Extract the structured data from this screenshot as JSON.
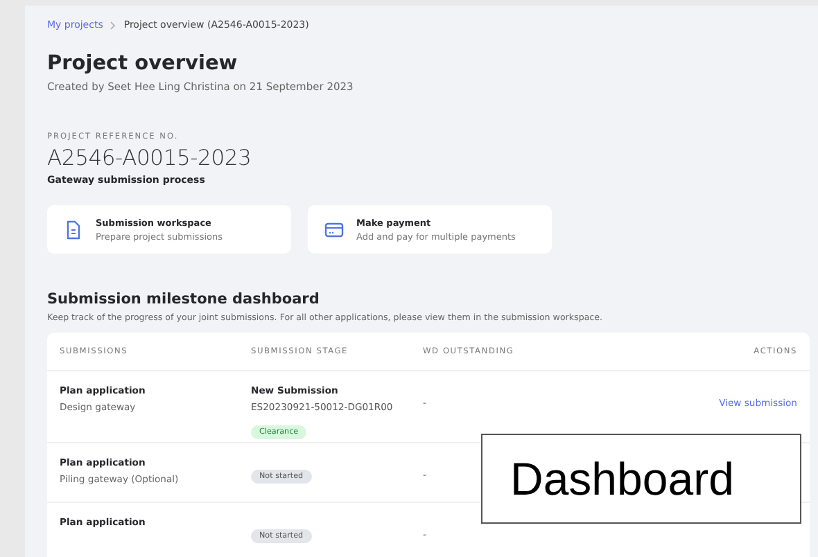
{
  "breadcrumb": [
    {
      "label": "My projects",
      "kind": "link"
    },
    {
      "label": "Project overview (A2546-A0015-2023)",
      "kind": "current"
    }
  ],
  "title": "Project overview",
  "subtitle": "Created by Seet Hee Ling Christina on 21 September 2023",
  "reference": {
    "label": "PROJECT REFERENCE NO.",
    "value": "A2546-A0015-2023",
    "process": "Gateway submission process"
  },
  "shortcuts": [
    {
      "kind": "document",
      "title": "Submission workspace",
      "desc": "Prepare project submissions"
    },
    {
      "kind": "payment",
      "title": "Make payment",
      "desc": "Add and pay for multiple payments"
    }
  ],
  "dashboard": {
    "title": "Submission milestone dashboard",
    "desc": "Keep track of the progress of your joint submissions. For all other applications, please view them in the submission workspace.",
    "columns": [
      "SUBMISSIONS",
      "SUBMISSION STAGE",
      "WD OUTSTANDING",
      "ACTIONS"
    ],
    "rows": [
      {
        "name": "Plan application",
        "gateway": "Design gateway",
        "stage": "New Submission",
        "ref": "ES20230921-50012-DG01R00",
        "status": {
          "label": "Clearance",
          "kind": "success"
        },
        "wd": "-",
        "action": "View submission"
      },
      {
        "name": "Plan application",
        "gateway": "Piling gateway (Optional)",
        "status": {
          "label": "Not started",
          "kind": "neutral"
        },
        "wd": "-"
      },
      {
        "name": "Plan application",
        "status": {
          "label": "Not started",
          "kind": "neutral"
        },
        "wd": "-"
      }
    ]
  },
  "annotation": "Dashboard"
}
